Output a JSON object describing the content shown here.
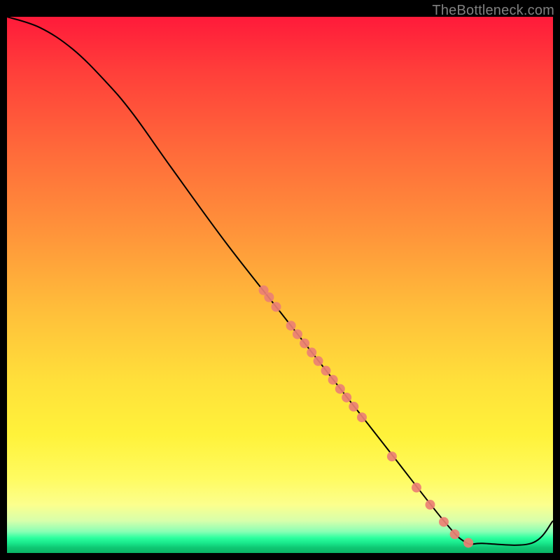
{
  "watermark": "TheBottleneck.com",
  "chart_data": {
    "type": "line",
    "title": "",
    "xlabel": "",
    "ylabel": "",
    "xlim": [
      0,
      100
    ],
    "ylim": [
      0,
      100
    ],
    "curve": [
      {
        "x": 0,
        "y": 100
      },
      {
        "x": 6,
        "y": 98
      },
      {
        "x": 12,
        "y": 94
      },
      {
        "x": 18,
        "y": 88
      },
      {
        "x": 23,
        "y": 82
      },
      {
        "x": 30,
        "y": 72
      },
      {
        "x": 40,
        "y": 58
      },
      {
        "x": 50,
        "y": 45
      },
      {
        "x": 60,
        "y": 32
      },
      {
        "x": 70,
        "y": 19
      },
      {
        "x": 80,
        "y": 6
      },
      {
        "x": 84,
        "y": 2
      },
      {
        "x": 87,
        "y": 1.8
      },
      {
        "x": 96,
        "y": 1.8
      },
      {
        "x": 100,
        "y": 6
      }
    ],
    "points": [
      {
        "x": 47,
        "y": 49
      },
      {
        "x": 48,
        "y": 47.7
      },
      {
        "x": 49.3,
        "y": 45.9
      },
      {
        "x": 52,
        "y": 42.4
      },
      {
        "x": 53.2,
        "y": 40.8
      },
      {
        "x": 54.5,
        "y": 39.1
      },
      {
        "x": 55.8,
        "y": 37.4
      },
      {
        "x": 57,
        "y": 35.8
      },
      {
        "x": 58.4,
        "y": 34
      },
      {
        "x": 59.7,
        "y": 32.3
      },
      {
        "x": 61,
        "y": 30.6
      },
      {
        "x": 62.2,
        "y": 29
      },
      {
        "x": 63.5,
        "y": 27.3
      },
      {
        "x": 65,
        "y": 25.3
      },
      {
        "x": 70.5,
        "y": 18
      },
      {
        "x": 75,
        "y": 12.2
      },
      {
        "x": 77.5,
        "y": 9
      },
      {
        "x": 80,
        "y": 5.8
      },
      {
        "x": 82,
        "y": 3.5
      },
      {
        "x": 84.5,
        "y": 1.9
      }
    ],
    "point_color": "#ec8074",
    "curve_color": "#000000",
    "curve_width": 2,
    "point_radius": 7
  }
}
